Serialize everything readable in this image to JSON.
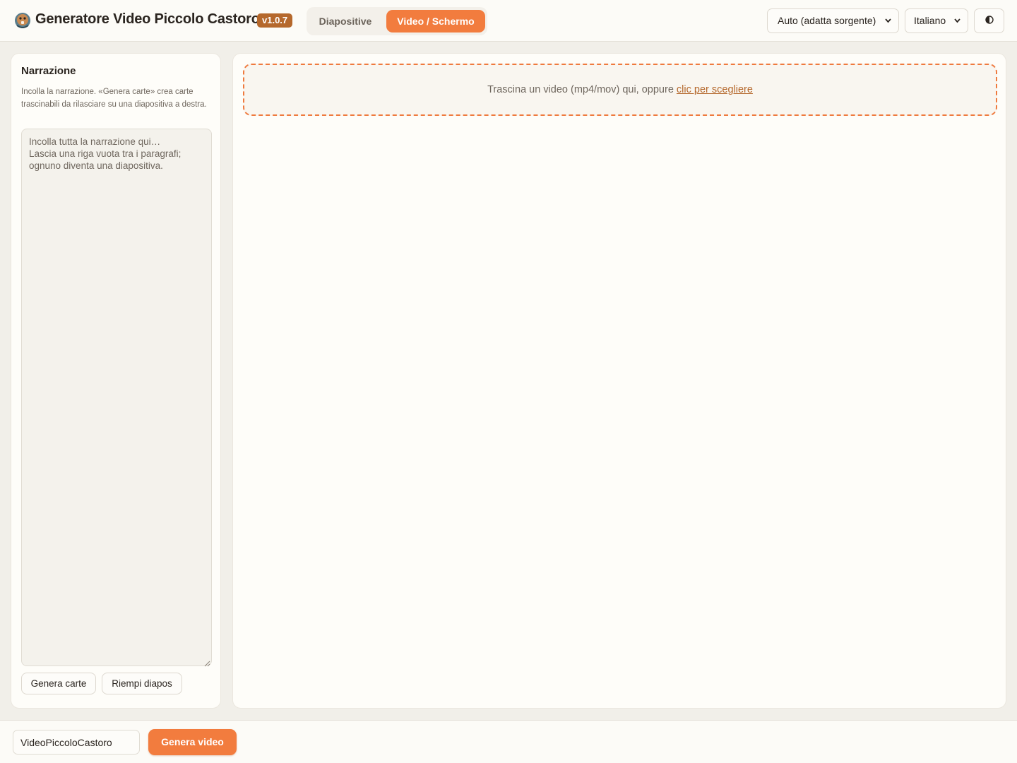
{
  "header": {
    "app_title": "Generatore Video Piccolo Castoro",
    "version": "v1.0.7",
    "tabs": [
      {
        "label": "Diapositive",
        "active": false
      },
      {
        "label": "Video / Schermo",
        "active": true
      }
    ],
    "format_select": {
      "value": "Auto (adatta sorgente)"
    },
    "language_select": {
      "value": "Italiano"
    },
    "theme_toggle": {
      "icon": "contrast-icon"
    }
  },
  "narration": {
    "title": "Narrazione",
    "description": "Incolla la narrazione. «Genera carte» crea carte trascinabili da rilasciare su una diapositiva a destra.",
    "placeholder": "Incolla tutta la narrazione qui…\nLascia una riga vuota tra i paragrafi; ognuno diventa una diapositiva.",
    "value": "",
    "buttons": {
      "generate_cards": "Genera carte",
      "fill_slides": "Riempi diapos"
    }
  },
  "dropzone": {
    "text": "Trascina un video (mp4/mov) qui, oppure ",
    "link": "clic per scegliere"
  },
  "footer": {
    "filename_value": "VideoPiccoloCastoro",
    "generate_label": "Genera video"
  },
  "colors": {
    "accent": "#f27c3e",
    "badge": "#b5682c",
    "background": "#f1efe9",
    "panel": "#fefdf9"
  }
}
